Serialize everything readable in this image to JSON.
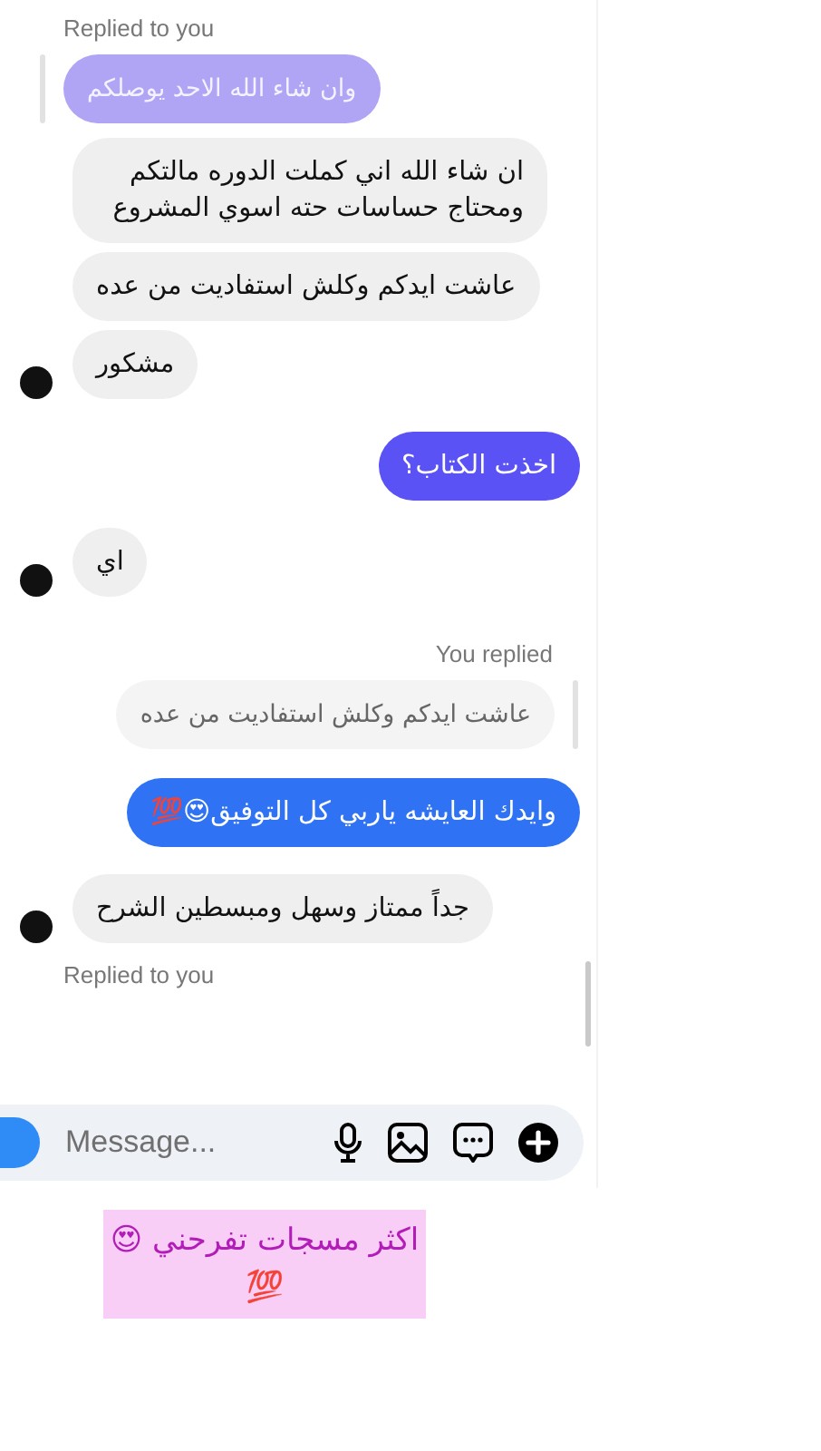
{
  "messages": [
    {
      "kind": "reply_label",
      "outgoing": false,
      "text": "Replied to you"
    },
    {
      "kind": "quoted",
      "outgoing": false,
      "text": "وان شاء الله الاحد يوصلكم"
    },
    {
      "kind": "received",
      "avatar": false,
      "text": "ان شاء الله اني كملت الدوره مالتكم ومحتاج حساسات حته اسوي المشروع"
    },
    {
      "kind": "received",
      "avatar": false,
      "text": "عاشت ايدكم وكلش استفاديت من عده"
    },
    {
      "kind": "received",
      "avatar": true,
      "text": "مشكور"
    },
    {
      "kind": "sent",
      "color": "#5a52f4",
      "text": "اخذت الكتاب؟"
    },
    {
      "kind": "received",
      "avatar": true,
      "text": "اي"
    },
    {
      "kind": "reply_label",
      "outgoing": true,
      "text": "You replied"
    },
    {
      "kind": "quoted",
      "outgoing": true,
      "text": "عاشت ايدكم وكلش استفاديت من عده"
    },
    {
      "kind": "sent",
      "color": "#2f73f4",
      "text": "وايدك العايشه ياربي كل التوفيق😍💯"
    },
    {
      "kind": "received",
      "avatar": true,
      "text": "جداً ممتاز وسهل ومبسطين الشرح"
    },
    {
      "kind": "reply_label",
      "outgoing": false,
      "text": "Replied to you"
    }
  ],
  "composer": {
    "placeholder": "Message..."
  },
  "caption": "اكثر مسجات تفرحني 😍💯"
}
